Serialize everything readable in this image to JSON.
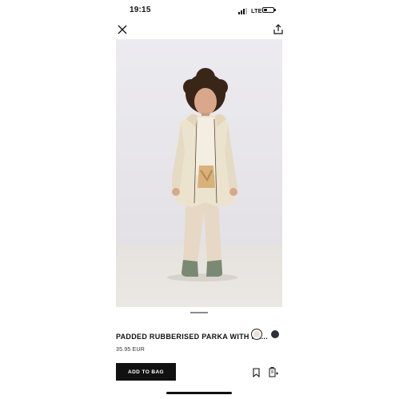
{
  "status_bar": {
    "time": "19:15",
    "network": "LTE",
    "battery_level": 0.35
  },
  "nav": {
    "close_icon": "close-icon",
    "share_icon": "share-icon"
  },
  "product": {
    "image_description_icon": "product-photo",
    "title": "PADDED RUBBERISED PARKA WITH FA...",
    "price": "35.95 EUR",
    "colors": [
      {
        "hex": "#e8e0d2",
        "selected": true
      },
      {
        "hex": "#2b2f3a",
        "selected": false
      }
    ],
    "gallery": {
      "page": 1
    }
  },
  "actions": {
    "add_to_bag": "ADD TO BAG",
    "bookmark_icon": "bookmark-icon",
    "find_size_icon": "find-size-icon"
  },
  "colors": {
    "primary": "#111111",
    "background": "#ffffff"
  }
}
